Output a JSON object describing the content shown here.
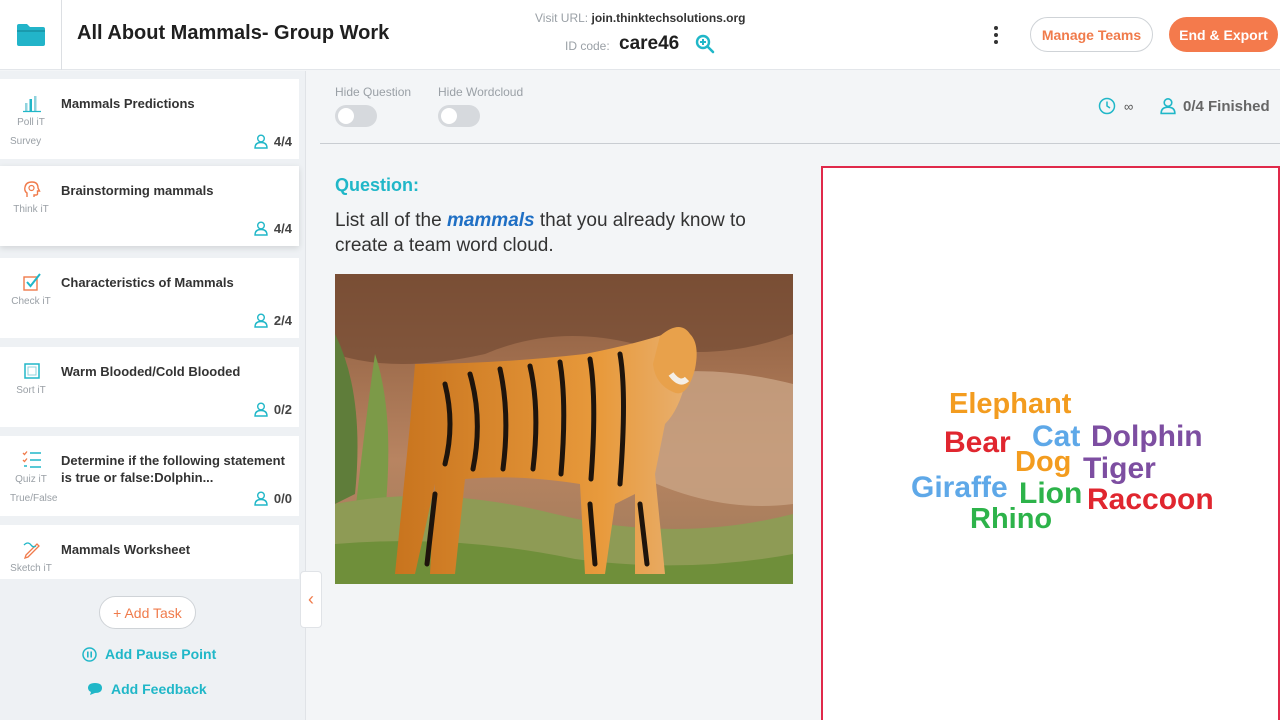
{
  "header": {
    "title": "All About Mammals- Group Work",
    "visit_url_label": "Visit URL:",
    "visit_url": "join.thinktechsolutions.org",
    "id_label": "ID code:",
    "id_code": "care46",
    "manage_teams": "Manage Teams",
    "end_export": "End & Export"
  },
  "sidebar": {
    "tasks": [
      {
        "title": "Mammals Predictions",
        "type": "Poll iT",
        "subtype": "Survey",
        "count": "4/4",
        "icon": "poll-chart-icon"
      },
      {
        "title": "Brainstorming mammals",
        "type": "Think iT",
        "count": "4/4",
        "icon": "think-head-icon"
      },
      {
        "title": "Characteristics of Mammals",
        "type": "Check iT",
        "count": "2/4",
        "icon": "checkbox-icon"
      },
      {
        "title": "Warm Blooded/Cold Blooded",
        "type": "Sort iT",
        "count": "0/2",
        "icon": "sort-square-icon"
      },
      {
        "title": "Determine if the following statement is true or false:Dolphin...",
        "type": "Quiz iT",
        "subtype": "True/False",
        "count": "0/0",
        "icon": "quiz-list-icon"
      },
      {
        "title": "Mammals Worksheet",
        "type": "Sketch iT",
        "icon": "sketch-pencil-icon"
      }
    ],
    "add_task": "+ Add Task",
    "add_pause": "Add Pause Point",
    "add_feedback": "Add Feedback"
  },
  "main": {
    "hide_question": "Hide Question",
    "hide_wordcloud": "Hide Wordcloud",
    "timer": "∞",
    "finished": "0/4 Finished",
    "question_label": "Question:",
    "question_pre": "List all of the ",
    "question_em": "mammals",
    "question_post": " that you already know to create a team word cloud."
  },
  "wordcloud": {
    "words": [
      {
        "text": "Elephant",
        "color": "#f39c1f"
      },
      {
        "text": "Bear",
        "color": "#e0262f"
      },
      {
        "text": "Cat",
        "color": "#5ea8e8"
      },
      {
        "text": "Dolphin",
        "color": "#7d4ea1"
      },
      {
        "text": "Dog",
        "color": "#f39c1f"
      },
      {
        "text": "Tiger",
        "color": "#7d4ea1"
      },
      {
        "text": "Giraffe",
        "color": "#5ea8e8"
      },
      {
        "text": "Lion",
        "color": "#2db34a"
      },
      {
        "text": "Raccoon",
        "color": "#e0262f"
      },
      {
        "text": "Rhino",
        "color": "#2db34a"
      }
    ]
  },
  "colors": {
    "accent_teal": "#20b7c8",
    "accent_orange": "#f47a4c",
    "cloud_border": "#e0294a"
  }
}
